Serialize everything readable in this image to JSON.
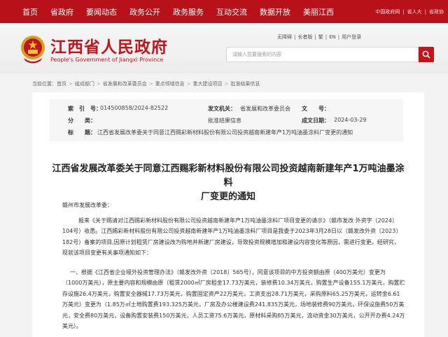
{
  "topnav": {
    "items": [
      "首页",
      "省政府",
      "要闻动态",
      "政务公开",
      "政务服务",
      "互动交流",
      "数据开放",
      "美丽江西"
    ],
    "right_links": [
      "中国政府网",
      "省人大",
      "省政协"
    ]
  },
  "header": {
    "title": "江西省人民政府",
    "subtitle": "People's Government of Jiangxi Province",
    "links": [
      "无障碍",
      "长者版",
      "繁",
      "EN",
      "用户登录"
    ],
    "search_placeholder": "请输入您要搜索的内容"
  },
  "breadcrumb": [
    "首页",
    "组成部门",
    "省发展和改革委员会",
    "重点领域信息",
    "重大建设项目",
    "批准结果信息"
  ],
  "info": {
    "index_label": "索　引　号：",
    "index_value": "014500858/2024-82522",
    "org_label": "发文机关：",
    "org_value": "省发展和改革委员会",
    "docno_label": "文　　号：",
    "docno_value": "",
    "category_label": "分　　类：",
    "category_value": "批准结果信息",
    "date_label": "成文日期：",
    "date_value": "2024-03-29",
    "subject_label": "标　　题：",
    "subject_value": "江西省发展改革委关于同意江西赐彩新材料股份有限公司投资越南新建年产1万吨油墨涂料厂变更的通知"
  },
  "doc": {
    "title_line1": "江西省发展改革委关于同意江西赐彩新材料股份有限公司投资越南新建年产1万吨油墨涂料",
    "title_line2": "厂变更的通知",
    "salutation": "赣州市发展改革委：",
    "para1": [
      "报来《关于赐请对江西赐彩新材料股份有限公司投资越南新建年产1万吨油墨涂料厂项目变更的请示》（赣市发改 外资字〔2024〕",
      "104号）收悉。江西赐彩新材料股份有限公司投资越南新建年产1万吨油墨涂料厂项目是我委于2023年3月28日以（赣发改外资〔2023〕",
      "182号）备案的项目,因原计划租赁厂房建设改为购地并新建厂房建设，导致投资规模增加和建设内容变化等原因，需进行变更。经研究，",
      "现就该项目变更有关事项通知如下："
    ],
    "para2": [
      "一、根据《江西省企业境外投资管理办法》（赣发改外资〔2018〕565号），同意该项目的中方投资额由原（400万美元）变更为",
      "（1000万美元），原主要内容和规模由原（租赁2000㎡厂房租金17.73万美元，装修费10.34万美元，购置生产设备155.1万美元，购置贮",
      "存设施26.4万美元，购置安全器械17.73万美元，购置固定资产22万美元，工资支出28.71万美元，采购原料65.25万美元，运转金6.61",
      "万美元）变更为（1.85万㎡土地购置费193.325万美元，厂房及办公楼建设费241.835万美元，场地装修费90万美元，环保设施费50万美",
      "元，安全费80万美元，设备购置安装费150万美元，人员工资75.6万美元，原材料采购85万美元，流动资金30万美元，公开开办费4.24万",
      "美元）。"
    ]
  }
}
